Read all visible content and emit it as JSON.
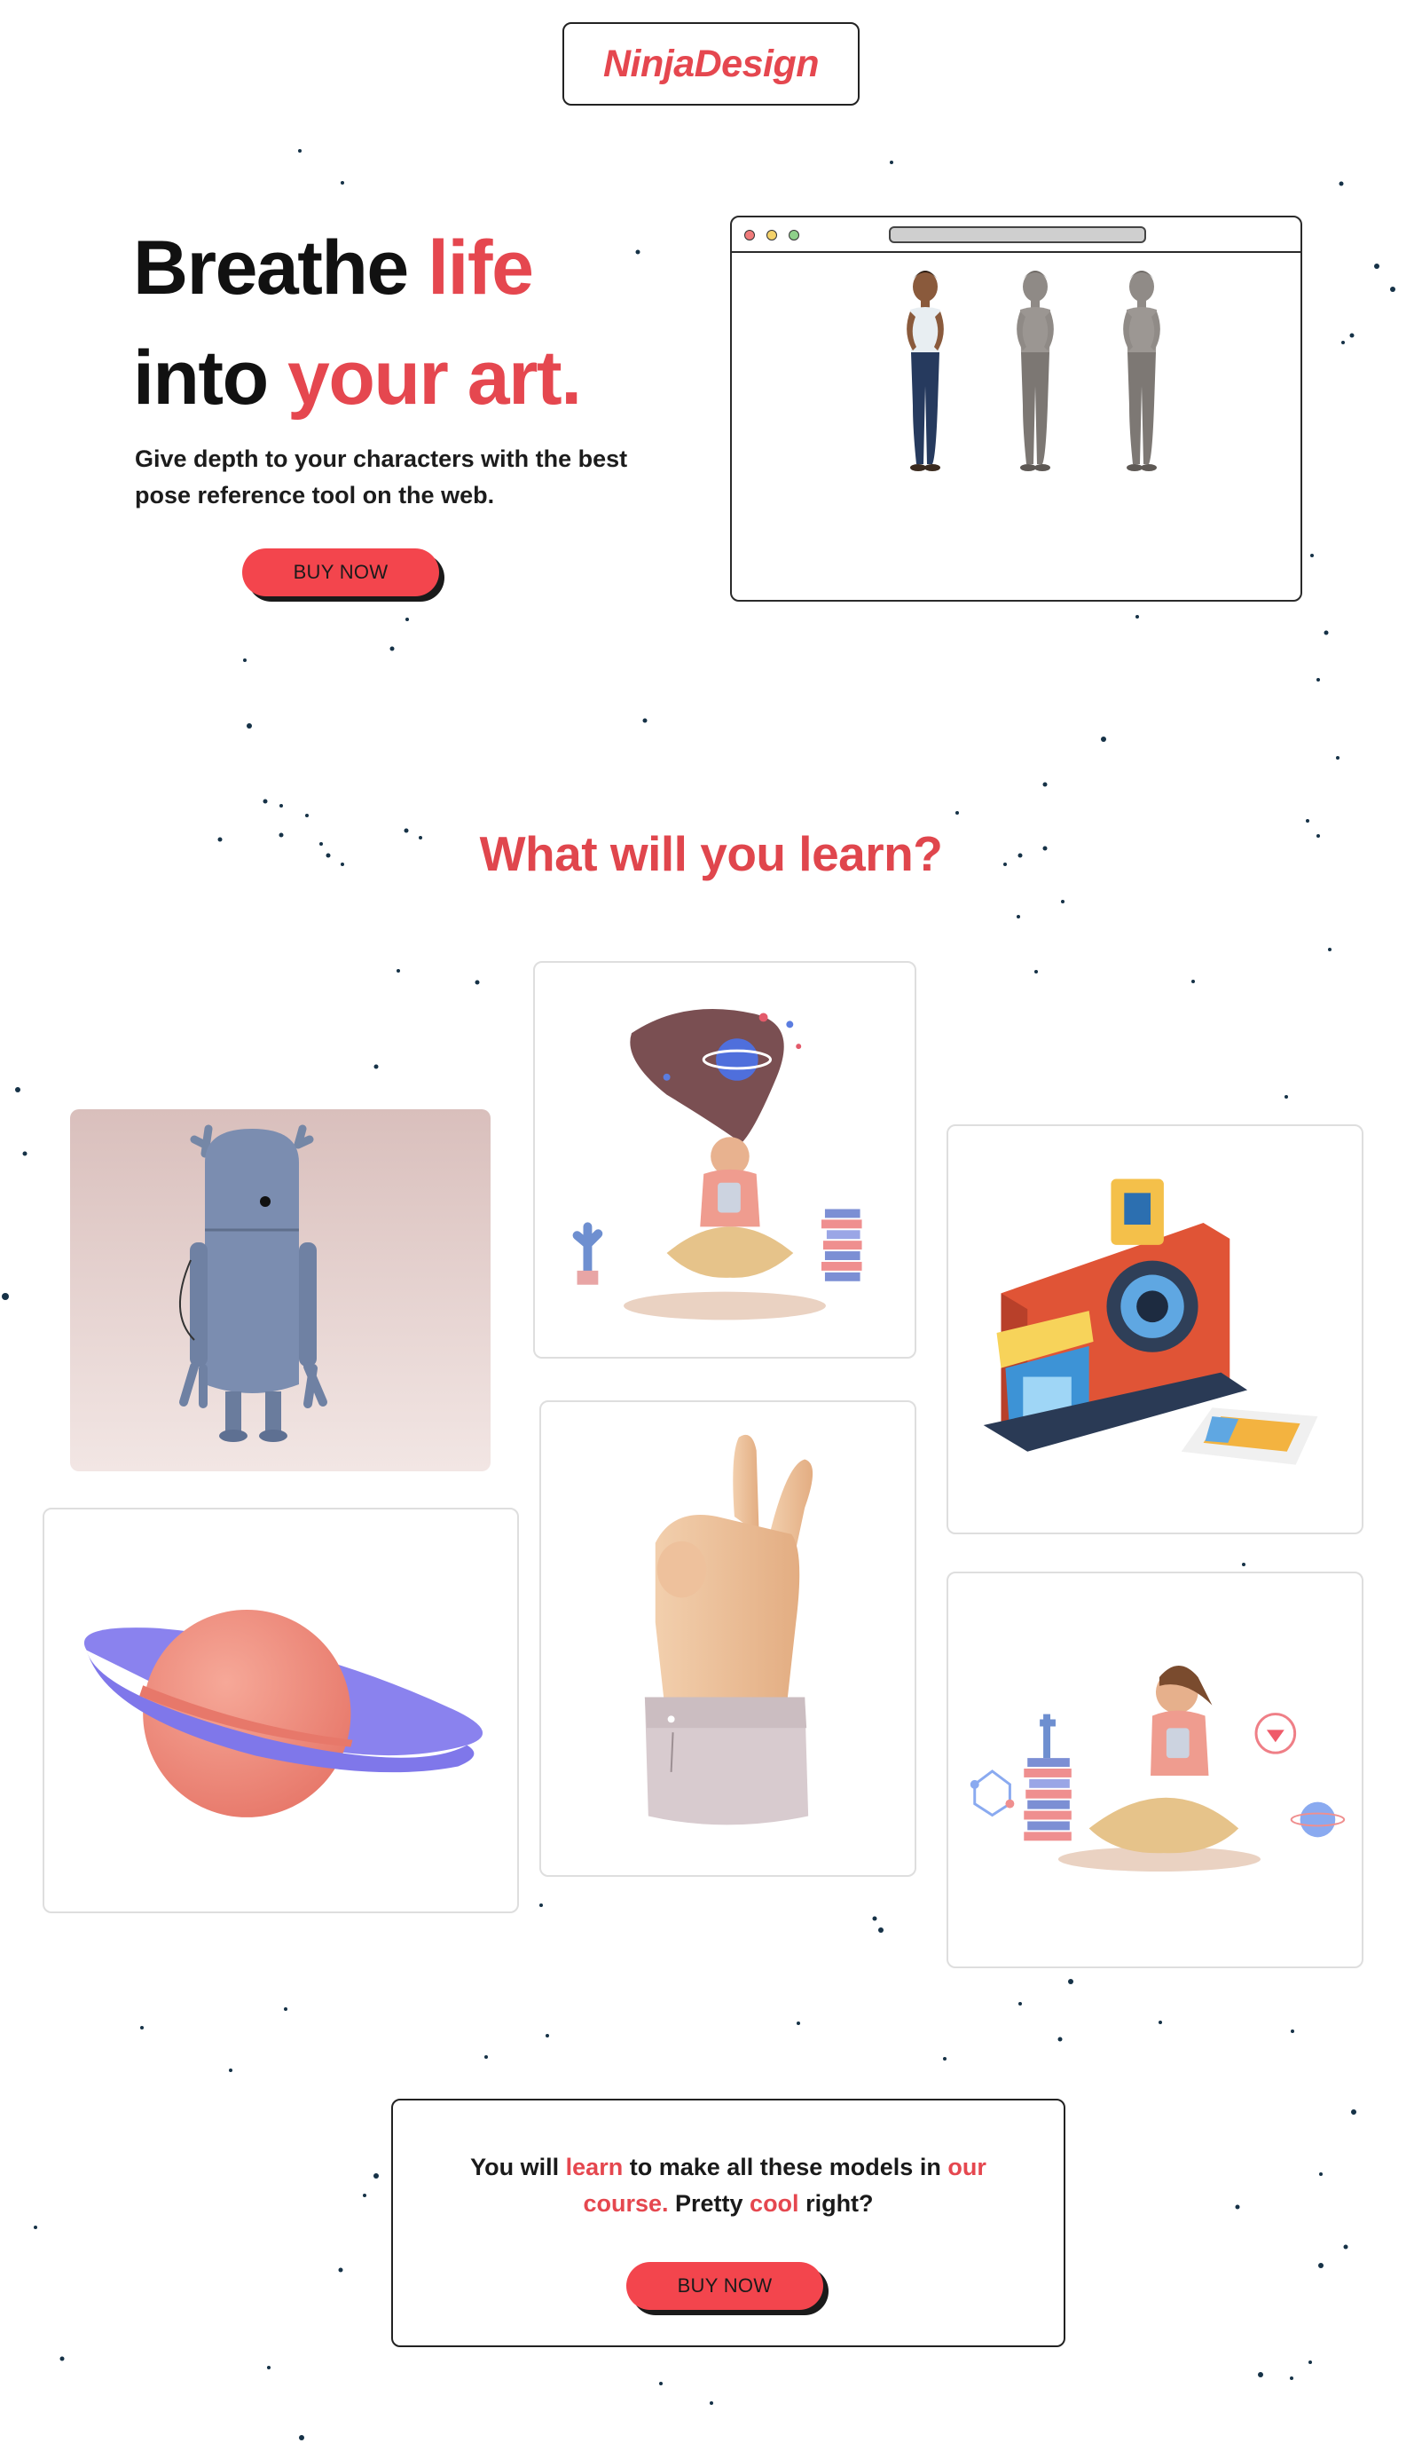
{
  "brand": {
    "logo_text": "NinjaDesign",
    "accent_color": "#e5474f",
    "button_color": "#f3454d"
  },
  "hero": {
    "title_line1_plain": "Breathe ",
    "title_line1_accent": "life",
    "title_line2_plain": "into ",
    "title_line2_accent": "your art.",
    "subtitle": "Give depth to your characters with the best pose reference tool on the web.",
    "buy_label": "BUY NOW",
    "preview_icon": "posed-character-figures-image"
  },
  "learn": {
    "heading": "What will you learn?",
    "cards": [
      {
        "icon": "robot-3d-image"
      },
      {
        "icon": "girl-with-flowing-hair-3d-image"
      },
      {
        "icon": "instant-camera-shop-3d-image"
      },
      {
        "icon": "ringed-planet-3d-image"
      },
      {
        "icon": "peace-sign-hand-3d-image"
      },
      {
        "icon": "girl-reading-books-3d-image"
      }
    ]
  },
  "cta": {
    "part1": "You will ",
    "part2": "learn",
    "part3": " to make all these models in ",
    "part4": "our course.",
    "part5": " Pretty ",
    "part6": "cool",
    "part7": " right?",
    "buy_label": "BUY NOW"
  }
}
